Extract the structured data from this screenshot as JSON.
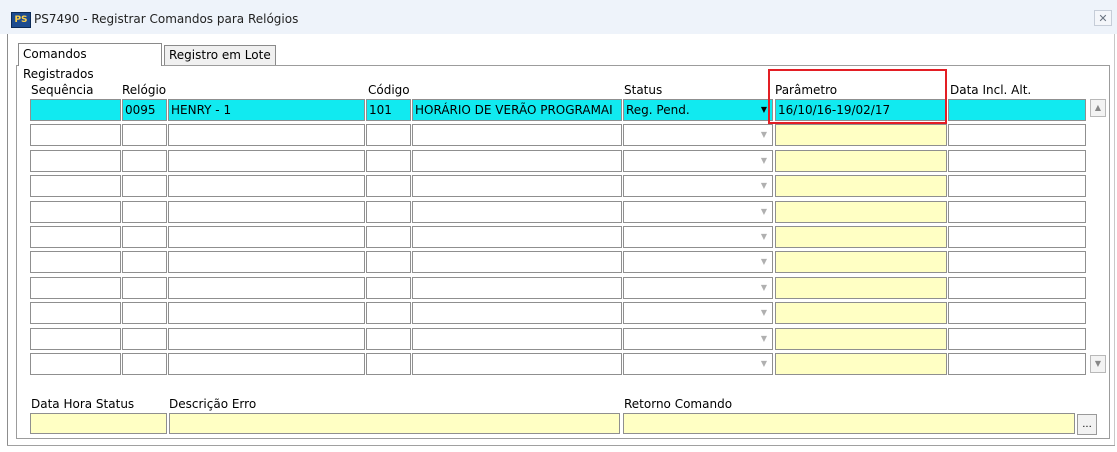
{
  "window": {
    "title": "PS7490 - Registrar Comandos para Relógios",
    "icon": "app-icon",
    "icon_text": "PS",
    "close_symbol": "✕"
  },
  "tabs": [
    {
      "label": "Comandos Registrados",
      "active": true
    },
    {
      "label": "Registro em Lote",
      "active": false
    }
  ],
  "grid": {
    "headers": {
      "sequencia": "Sequência",
      "relogio": "Relógio",
      "codigo": "Código",
      "status": "Status",
      "parametro": "Parâmetro",
      "data_incl": "Data Incl. Alt."
    },
    "rows": [
      {
        "sequencia": "",
        "relogio_num": "0095",
        "relogio_nome": "HENRY - 1",
        "codigo": "101",
        "codigo_desc": "HORÁRIO DE VERÃO PROGRAMAI",
        "status": "Reg. Pend.",
        "parametro": "16/10/16-19/02/17",
        "data_incl": ""
      },
      {
        "sequencia": "",
        "relogio_num": "",
        "relogio_nome": "",
        "codigo": "",
        "codigo_desc": "",
        "status": "",
        "parametro": "",
        "data_incl": ""
      },
      {
        "sequencia": "",
        "relogio_num": "",
        "relogio_nome": "",
        "codigo": "",
        "codigo_desc": "",
        "status": "",
        "parametro": "",
        "data_incl": ""
      },
      {
        "sequencia": "",
        "relogio_num": "",
        "relogio_nome": "",
        "codigo": "",
        "codigo_desc": "",
        "status": "",
        "parametro": "",
        "data_incl": ""
      },
      {
        "sequencia": "",
        "relogio_num": "",
        "relogio_nome": "",
        "codigo": "",
        "codigo_desc": "",
        "status": "",
        "parametro": "",
        "data_incl": ""
      },
      {
        "sequencia": "",
        "relogio_num": "",
        "relogio_nome": "",
        "codigo": "",
        "codigo_desc": "",
        "status": "",
        "parametro": "",
        "data_incl": ""
      },
      {
        "sequencia": "",
        "relogio_num": "",
        "relogio_nome": "",
        "codigo": "",
        "codigo_desc": "",
        "status": "",
        "parametro": "",
        "data_incl": ""
      },
      {
        "sequencia": "",
        "relogio_num": "",
        "relogio_nome": "",
        "codigo": "",
        "codigo_desc": "",
        "status": "",
        "parametro": "",
        "data_incl": ""
      },
      {
        "sequencia": "",
        "relogio_num": "",
        "relogio_nome": "",
        "codigo": "",
        "codigo_desc": "",
        "status": "",
        "parametro": "",
        "data_incl": ""
      },
      {
        "sequencia": "",
        "relogio_num": "",
        "relogio_nome": "",
        "codigo": "",
        "codigo_desc": "",
        "status": "",
        "parametro": "",
        "data_incl": ""
      },
      {
        "sequencia": "",
        "relogio_num": "",
        "relogio_nome": "",
        "codigo": "",
        "codigo_desc": "",
        "status": "",
        "parametro": "",
        "data_incl": ""
      }
    ],
    "scroll_up_symbol": "▲",
    "scroll_down_symbol": "▼",
    "dropdown_symbol": "▼"
  },
  "bottom": {
    "data_hora_status_label": "Data Hora Status",
    "descricao_erro_label": "Descrição Erro",
    "retorno_comando_label": "Retorno Comando",
    "data_hora_status_value": "",
    "descricao_erro_value": "",
    "retorno_comando_value": "",
    "lookup_button": "..."
  },
  "colors": {
    "selected_row": "#11eaf0",
    "editable_field": "#ffffc4",
    "highlight_border": "#e31e24"
  }
}
